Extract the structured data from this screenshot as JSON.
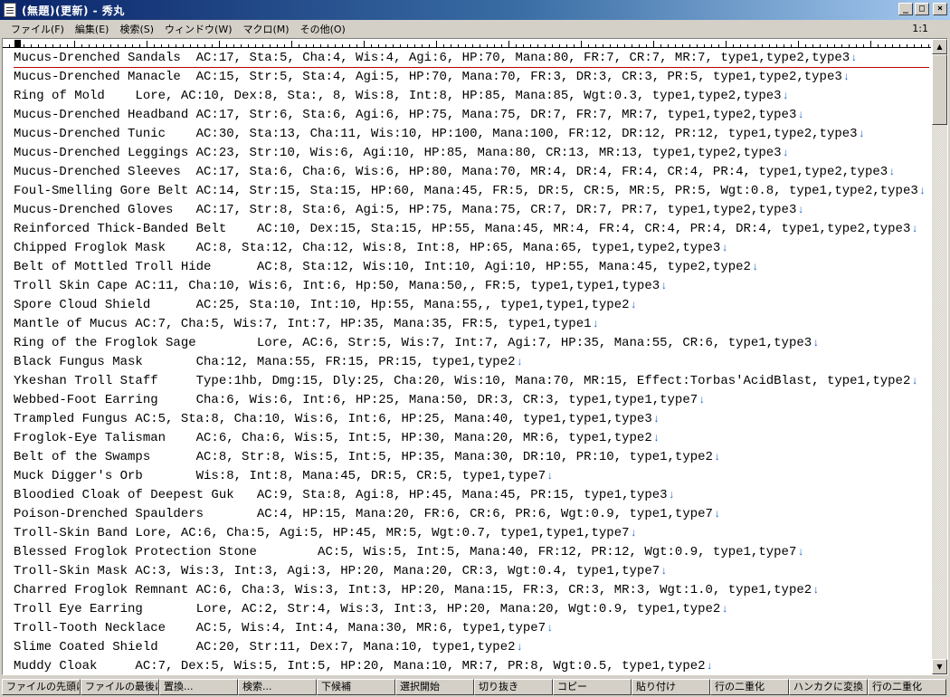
{
  "window": {
    "title": "(無題)(更新) - 秀丸",
    "minimize": "_",
    "maximize": "□",
    "close": "×"
  },
  "menu": {
    "items": [
      "ファイル(F)",
      "編集(E)",
      "検索(S)",
      "ウィンドウ(W)",
      "マクロ(M)",
      "その他(O)"
    ],
    "position_indicator": "1:1"
  },
  "editor": {
    "eol_mark": "↓",
    "lines": [
      "Mucus-Drenched Sandals  AC:17, Sta:5, Cha:4, Wis:4, Agi:6, HP:70, Mana:80, FR:7, CR:7, MR:7, type1,type2,type3",
      "Mucus-Drenched Manacle  AC:15, Str:5, Sta:4, Agi:5, HP:70, Mana:70, FR:3, DR:3, CR:3, PR:5, type1,type2,type3",
      "Ring of Mold    Lore, AC:10, Dex:8, Sta:, 8, Wis:8, Int:8, HP:85, Mana:85, Wgt:0.3, type1,type2,type3",
      "Mucus-Drenched Headband AC:17, Str:6, Sta:6, Agi:6, HP:75, Mana:75, DR:7, FR:7, MR:7, type1,type2,type3",
      "Mucus-Drenched Tunic    AC:30, Sta:13, Cha:11, Wis:10, HP:100, Mana:100, FR:12, DR:12, PR:12, type1,type2,type3",
      "Mucus-Drenched Leggings AC:23, Str:10, Wis:6, Agi:10, HP:85, Mana:80, CR:13, MR:13, type1,type2,type3",
      "Mucus-Drenched Sleeves  AC:17, Sta:6, Cha:6, Wis:6, HP:80, Mana:70, MR:4, DR:4, FR:4, CR:4, PR:4, type1,type2,type3",
      "Foul-Smelling Gore Belt AC:14, Str:15, Sta:15, HP:60, Mana:45, FR:5, DR:5, CR:5, MR:5, PR:5, Wgt:0.8, type1,type2,type3",
      "Mucus-Drenched Gloves   AC:17, Str:8, Sta:6, Agi:5, HP:75, Mana:75, CR:7, DR:7, PR:7, type1,type2,type3",
      "Reinforced Thick-Banded Belt    AC:10, Dex:15, Sta:15, HP:55, Mana:45, MR:4, FR:4, CR:4, PR:4, DR:4, type1,type2,type3",
      "Chipped Froglok Mask    AC:8, Sta:12, Cha:12, Wis:8, Int:8, HP:65, Mana:65, type1,type2,type3",
      "Belt of Mottled Troll Hide      AC:8, Sta:12, Wis:10, Int:10, Agi:10, HP:55, Mana:45, type2,type2",
      "Troll Skin Cape AC:11, Cha:10, Wis:6, Int:6, Hp:50, Mana:50,, FR:5, type1,type1,type3",
      "Spore Cloud Shield      AC:25, Sta:10, Int:10, Hp:55, Mana:55,, type1,type1,type2",
      "Mantle of Mucus AC:7, Cha:5, Wis:7, Int:7, HP:35, Mana:35, FR:5, type1,type1",
      "Ring of the Froglok Sage        Lore, AC:6, Str:5, Wis:7, Int:7, Agi:7, HP:35, Mana:55, CR:6, type1,type3",
      "Black Fungus Mask       Cha:12, Mana:55, FR:15, PR:15, type1,type2",
      "Ykeshan Troll Staff     Type:1hb, Dmg:15, Dly:25, Cha:20, Wis:10, Mana:70, MR:15, Effect:Torbas'AcidBlast, type1,type2",
      "Webbed-Foot Earring     Cha:6, Wis:6, Int:6, HP:25, Mana:50, DR:3, CR:3, type1,type1,type7",
      "Trampled Fungus AC:5, Sta:8, Cha:10, Wis:6, Int:6, HP:25, Mana:40, type1,type1,type3",
      "Froglok-Eye Talisman    AC:6, Cha:6, Wis:5, Int:5, HP:30, Mana:20, MR:6, type1,type2",
      "Belt of the Swamps      AC:8, Str:8, Wis:5, Int:5, HP:35, Mana:30, DR:10, PR:10, type1,type2",
      "Muck Digger's Orb       Wis:8, Int:8, Mana:45, DR:5, CR:5, type1,type7",
      "Bloodied Cloak of Deepest Guk   AC:9, Sta:8, Agi:8, HP:45, Mana:45, PR:15, type1,type3",
      "Poison-Drenched Spaulders       AC:4, HP:15, Mana:20, FR:6, CR:6, PR:6, Wgt:0.9, type1,type7",
      "Troll-Skin Band Lore, AC:6, Cha:5, Agi:5, HP:45, MR:5, Wgt:0.7, type1,type1,type7",
      "Blessed Froglok Protection Stone        AC:5, Wis:5, Int:5, Mana:40, FR:12, PR:12, Wgt:0.9, type1,type7",
      "Troll-Skin Mask AC:3, Wis:3, Int:3, Agi:3, HP:20, Mana:20, CR:3, Wgt:0.4, type1,type7",
      "Charred Froglok Remnant AC:6, Cha:3, Wis:3, Int:3, HP:20, Mana:15, FR:3, CR:3, MR:3, Wgt:1.0, type1,type2",
      "Troll Eye Earring       Lore, AC:2, Str:4, Wis:3, Int:3, HP:20, Mana:20, Wgt:0.9, type1,type2",
      "Troll-Tooth Necklace    AC:5, Wis:4, Int:4, Mana:30, MR:6, type1,type7",
      "Slime Coated Shield     AC:20, Str:11, Dex:7, Mana:10, type1,type2",
      "Muddy Cloak     AC:7, Dex:5, Wis:5, Int:5, HP:20, Mana:10, MR:7, PR:8, Wgt:0.5, type1,type2"
    ]
  },
  "function_keys": [
    "ファイルの先頭に移",
    "ファイルの最後に移",
    "置換...",
    "検索...",
    "下候補",
    "選択開始",
    "切り抜き",
    "コピー",
    "貼り付け",
    "行の二重化",
    "ハンカクに変換",
    "行の二重化"
  ]
}
